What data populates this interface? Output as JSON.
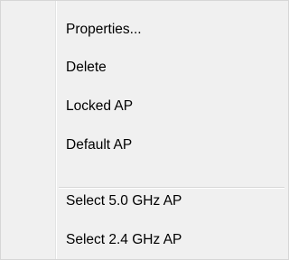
{
  "menu": {
    "group1": [
      {
        "label": "Properties..."
      },
      {
        "label": "Delete"
      },
      {
        "label": "Locked AP"
      },
      {
        "label": "Default AP"
      }
    ],
    "group2": [
      {
        "label": "Select 5.0 GHz AP"
      },
      {
        "label": "Select 2.4 GHz AP"
      }
    ]
  },
  "colors": {
    "menu_background": "#f0f0f0",
    "separator": "#d7d7d7",
    "text": "#000000"
  }
}
